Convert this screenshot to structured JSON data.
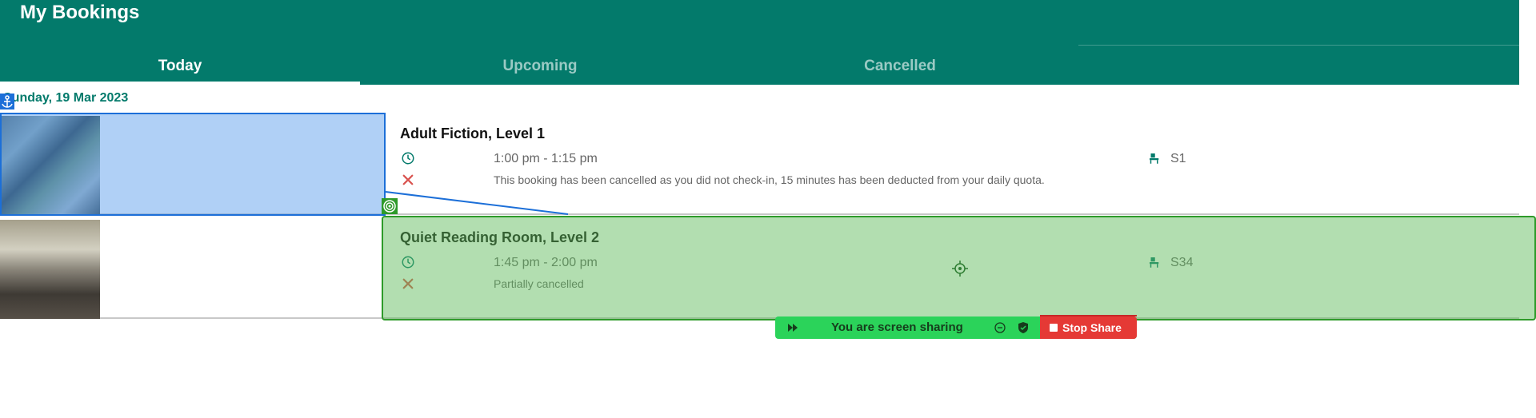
{
  "header": {
    "title": "My Bookings"
  },
  "tabs": [
    {
      "label": "Today",
      "active": true
    },
    {
      "label": "Upcoming",
      "active": false
    },
    {
      "label": "Cancelled",
      "active": false
    }
  ],
  "date_header": "Sunday, 19 Mar 2023",
  "bookings": [
    {
      "title": "Adult Fiction, Level 1",
      "time": "1:00 pm - 1:15 pm",
      "status_note": "This booking has been cancelled as you did not check-in, 15 minutes has been deducted from your daily quota.",
      "seat": "S1"
    },
    {
      "title": "Quiet Reading Room, Level 2",
      "time": "1:45 pm - 2:00 pm",
      "status_note": "Partially cancelled",
      "seat": "S34"
    }
  ],
  "share_bar": {
    "message": "You are screen sharing",
    "stop_label": "Stop Share"
  },
  "icons": {
    "clock": "clock-icon",
    "cancel": "cancel-x-icon",
    "seat": "seat-icon",
    "anchor": "anchor-icon",
    "target": "target-icon",
    "crosshair": "crosshair-icon"
  },
  "colors": {
    "primary": "#037a6b",
    "cancel_red": "#d9534f",
    "share_green": "#2bd35a",
    "stop_red": "#e53935",
    "highlight_blue": "#1c6fd8",
    "highlight_green": "#2e9a2a"
  }
}
